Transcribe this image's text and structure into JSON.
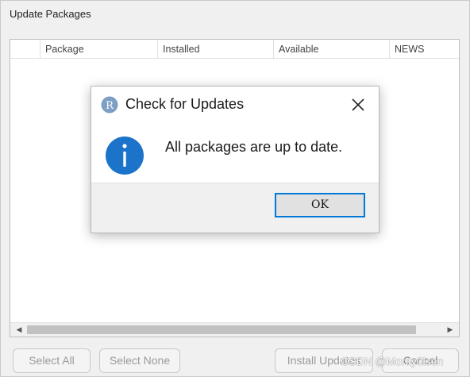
{
  "window": {
    "title": "Update Packages"
  },
  "table": {
    "columns": [
      "Package",
      "Installed",
      "Available",
      "NEWS"
    ]
  },
  "buttons": {
    "select_all": "Select All",
    "select_none": "Select None",
    "install_updates": "Install Updates",
    "cancel": "Cancel"
  },
  "watermark": "CSDN @Monty0lsen",
  "message_box": {
    "title": "Check for Updates",
    "message": "All packages are up to date.",
    "ok_label": "OK",
    "app_icon": "r-logo-icon",
    "info_icon": "info-icon"
  },
  "colors": {
    "accent": "#0078d7",
    "info_blue": "#1b74c9"
  }
}
